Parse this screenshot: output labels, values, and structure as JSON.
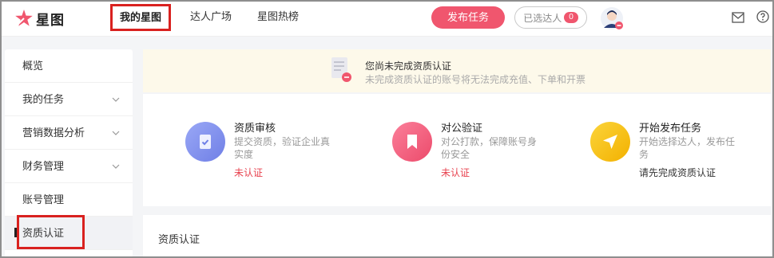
{
  "header": {
    "logo_text": "星图",
    "nav": [
      "我的星图",
      "达人广场",
      "星图热榜"
    ],
    "publish_label": "发布任务",
    "selected_label": "已选达人",
    "selected_count": "0"
  },
  "sidebar": {
    "items": [
      {
        "label": "概览",
        "icon": "none"
      },
      {
        "label": "我的任务",
        "icon": "chevron-down-icon"
      },
      {
        "label": "营销数据分析",
        "icon": "chevron-down-icon"
      },
      {
        "label": "财务管理",
        "icon": "chevron-down-icon"
      },
      {
        "label": "账号管理",
        "icon": "none"
      },
      {
        "label": "资质认证",
        "icon": "none"
      }
    ]
  },
  "banner": {
    "title": "您尚未完成资质认证",
    "subtitle": "未完成资质认证的账号将无法完成充值、下单和开票"
  },
  "steps": [
    {
      "title": "资质审核",
      "desc": "提交资质，验证企业真实度",
      "status": "未认证",
      "icon": "document-check-icon",
      "color": "#7b8cec"
    },
    {
      "title": "对公验证",
      "desc": "对公打款，保障账号身份安全",
      "status": "未认证",
      "icon": "bookmark-icon",
      "color": "#f05a78"
    },
    {
      "title": "开始发布任务",
      "desc": "开始选择达人，发布任务",
      "status": "请先完成资质认证",
      "icon": "send-arrow-icon",
      "color": "#f6c21a"
    }
  ],
  "section": {
    "title": "资质认证"
  },
  "colors": {
    "accent": "#f0566e",
    "highlight_box": "#d9211f",
    "unverified": "#e8424f"
  }
}
